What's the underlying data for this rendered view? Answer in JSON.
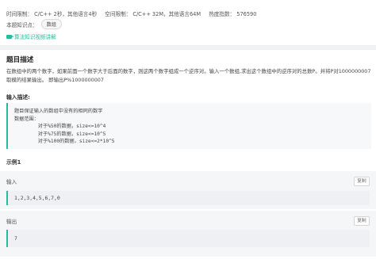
{
  "meta": {
    "time_limit": "时间限制： C/C++ 2秒，其他语言4秒",
    "memory_limit": "空间限制： C/C++ 32M，其他语言64M",
    "heat": "热度指数： 576590"
  },
  "knowledge": {
    "label": "本题知识点：",
    "tag": "数组"
  },
  "video_link": "算法知识视频讲解",
  "section_title": "题目描述",
  "description": "在数组中的两个数字，如果前面一个数字大于后面的数字，则这两个数字组成一个逆序对。输入一个数组,求出这个数组中的逆序对的总数P。并将P对1000000007取模的结果输出。 即输出P%1000000007",
  "input_title": "输入描述:",
  "input_desc": "题目保证输入的数组中没有的相同的数字\n数据范围：\n        对于%50的数据，size<=10^4\n        对于%75的数据，size<=10^5\n        对于%100的数据，size<=2*10^5",
  "example_title": "示例1",
  "example": {
    "input_label": "输入",
    "input_value": "1,2,3,4,5,6,7,0",
    "output_label": "输出",
    "output_value": "7",
    "copy_label": "复制"
  },
  "colors": {
    "accent": "#25bb9b"
  },
  "icons": {
    "video": "video-camera-icon"
  }
}
